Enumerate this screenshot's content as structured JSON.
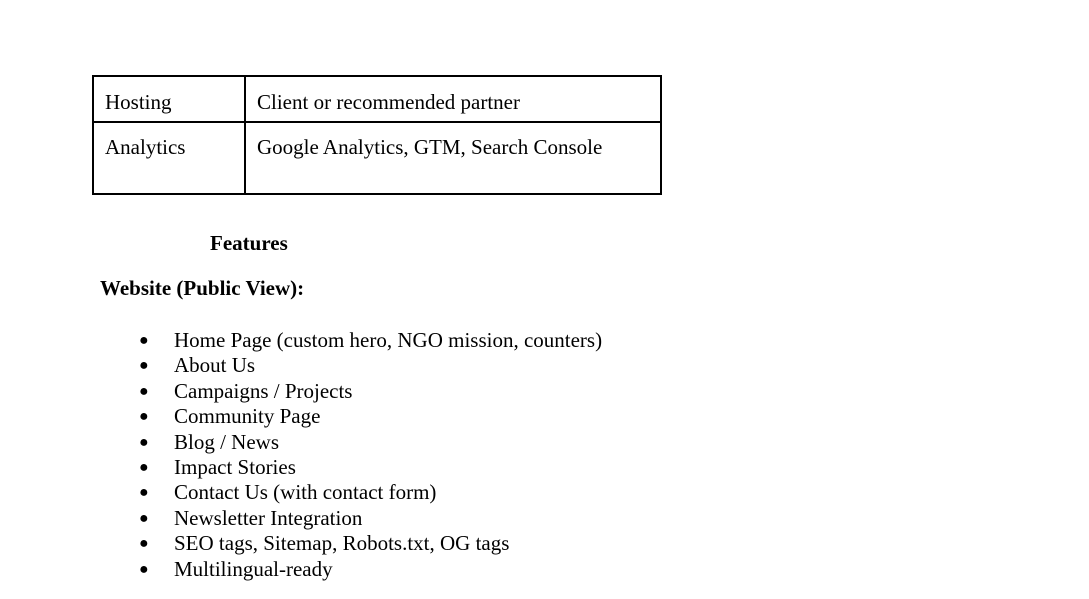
{
  "table": {
    "rows": [
      {
        "label": "Hosting",
        "value": "Client or recommended partner"
      },
      {
        "label": "Analytics",
        "value": "Google Analytics, GTM, Search Console"
      }
    ]
  },
  "features_heading": "Features",
  "website_heading": "Website (Public View):",
  "bullet_symbol": "●",
  "features": [
    "Home Page (custom hero, NGO mission, counters)",
    "About Us",
    "Campaigns / Projects",
    "Community Page",
    "Blog / News",
    "Impact Stories",
    "Contact Us (with contact form)",
    "Newsletter Integration",
    "SEO tags, Sitemap, Robots.txt, OG tags",
    "Multilingual-ready"
  ]
}
